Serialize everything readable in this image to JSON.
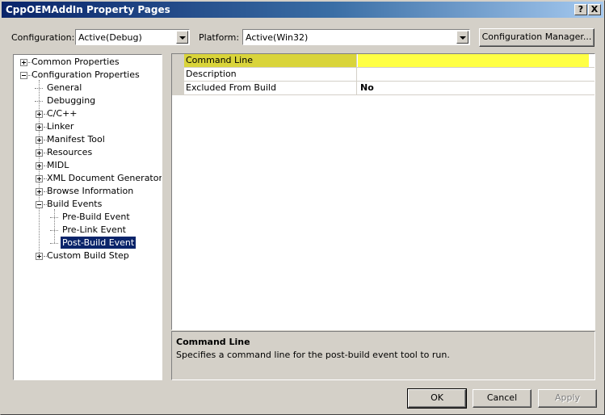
{
  "window": {
    "title": "CppOEMAddIn Property Pages",
    "help_glyph": "?",
    "close_glyph": "X"
  },
  "top": {
    "configuration_label": "Configuration:",
    "configuration_value": "Active(Debug)",
    "platform_label": "Platform:",
    "platform_value": "Active(Win32)",
    "config_manager_label": "Configuration Manager..."
  },
  "tree": {
    "nodes": [
      {
        "label": "Common Properties",
        "expander": "plus"
      },
      {
        "label": "Configuration Properties",
        "expander": "minus"
      },
      {
        "label": "General",
        "expander": "none"
      },
      {
        "label": "Debugging",
        "expander": "none"
      },
      {
        "label": "C/C++",
        "expander": "plus"
      },
      {
        "label": "Linker",
        "expander": "plus"
      },
      {
        "label": "Manifest Tool",
        "expander": "plus"
      },
      {
        "label": "Resources",
        "expander": "plus"
      },
      {
        "label": "MIDL",
        "expander": "plus"
      },
      {
        "label": "XML Document Generator",
        "expander": "plus"
      },
      {
        "label": "Browse Information",
        "expander": "plus"
      },
      {
        "label": "Build Events",
        "expander": "minus"
      },
      {
        "label": "Pre-Build Event",
        "expander": "none"
      },
      {
        "label": "Pre-Link Event",
        "expander": "none"
      },
      {
        "label": "Post-Build Event",
        "expander": "none",
        "selected": true
      },
      {
        "label": "Custom Build Step",
        "expander": "plus"
      }
    ]
  },
  "properties": {
    "rows": [
      {
        "name": "Command Line",
        "value": "",
        "selected": true
      },
      {
        "name": "Description",
        "value": ""
      },
      {
        "name": "Excluded From Build",
        "value": "No"
      }
    ]
  },
  "description": {
    "title": "Command Line",
    "text": "Specifies a command line for the post-build event tool to run."
  },
  "buttons": {
    "ok": "OK",
    "cancel": "Cancel",
    "apply": "Apply"
  },
  "colors": {
    "title_bar": "#0a246a",
    "selection": "#0a246a",
    "selected_property_name": "#d9d43a",
    "selected_property_value": "#ffff44",
    "face": "#d4d0c8"
  }
}
